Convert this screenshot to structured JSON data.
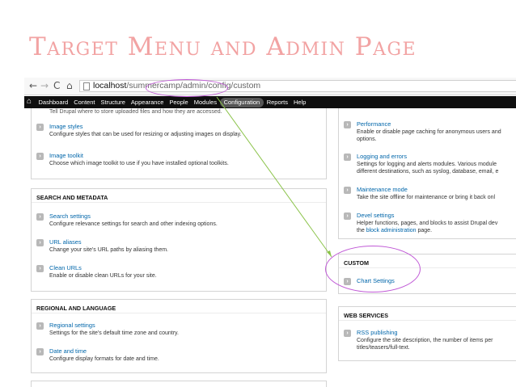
{
  "slide": {
    "title": "Target Menu and Admin Page"
  },
  "browser": {
    "nav": {
      "back": "←",
      "forward": "→",
      "reload": "C",
      "home": "⌂"
    },
    "url_host": "localhost",
    "url_path": "/summercamp/admin/config/custom"
  },
  "admin_menu": {
    "home_icon": "home-icon",
    "items": [
      "Dashboard",
      "Content",
      "Structure",
      "Appearance",
      "People",
      "Modules",
      "Configuration",
      "Reports",
      "Help"
    ],
    "active": "Configuration"
  },
  "left": {
    "media_cut_text": "Tell Drupal where to store uploaded files and how they are accessed.",
    "image_styles": {
      "title": "Image styles",
      "desc": "Configure styles that can be used for resizing or adjusting images on display."
    },
    "image_toolkit": {
      "title": "Image toolkit",
      "desc": "Choose which image toolkit to use if you have installed optional toolkits."
    },
    "search": {
      "header": "SEARCH AND METADATA",
      "search_settings": {
        "title": "Search settings",
        "desc": "Configure relevance settings for search and other indexing options."
      },
      "url_aliases": {
        "title": "URL aliases",
        "desc": "Change your site's URL paths by aliasing them."
      },
      "clean_urls": {
        "title": "Clean URLs",
        "desc": "Enable or disable clean URLs for your site."
      }
    },
    "regional": {
      "header": "REGIONAL AND LANGUAGE",
      "regional_settings": {
        "title": "Regional settings",
        "desc": "Settings for the site's default time zone and country."
      },
      "date_time": {
        "title": "Date and time",
        "desc": "Configure display formats for date and time."
      }
    }
  },
  "right": {
    "performance": {
      "title": "Performance",
      "desc1": "Enable or disable page caching for anonymous users and",
      "desc2": "options."
    },
    "logging": {
      "title": "Logging and errors",
      "desc1": "Settings for logging and alerts modules. Various module",
      "desc2": "different destinations, such as syslog, database, email, e"
    },
    "maintenance": {
      "title": "Maintenance mode",
      "desc1": "Take the site offline for maintenance or bring it back onl"
    },
    "devel": {
      "title": "Devel settings",
      "desc1": "Helper functions, pages, and blocks to assist Drupal dev",
      "desc2_prefix": "the ",
      "desc2_link": "block administration",
      "desc2_suffix": " page."
    },
    "custom": {
      "header": "CUSTOM",
      "chart_settings": {
        "title": "Chart Settings"
      }
    },
    "web_services": {
      "header": "WEB SERVICES",
      "rss": {
        "title": "RSS publishing",
        "desc1": "Configure the site description, the number of items per",
        "desc2": "titles/teasers/full-text."
      }
    }
  },
  "colors": {
    "title": "#f2a3a3",
    "link": "#0066aa",
    "highlight": "#c05ad6",
    "arrow": "#8bc34a",
    "admin_bar": "#0f0f0f"
  }
}
